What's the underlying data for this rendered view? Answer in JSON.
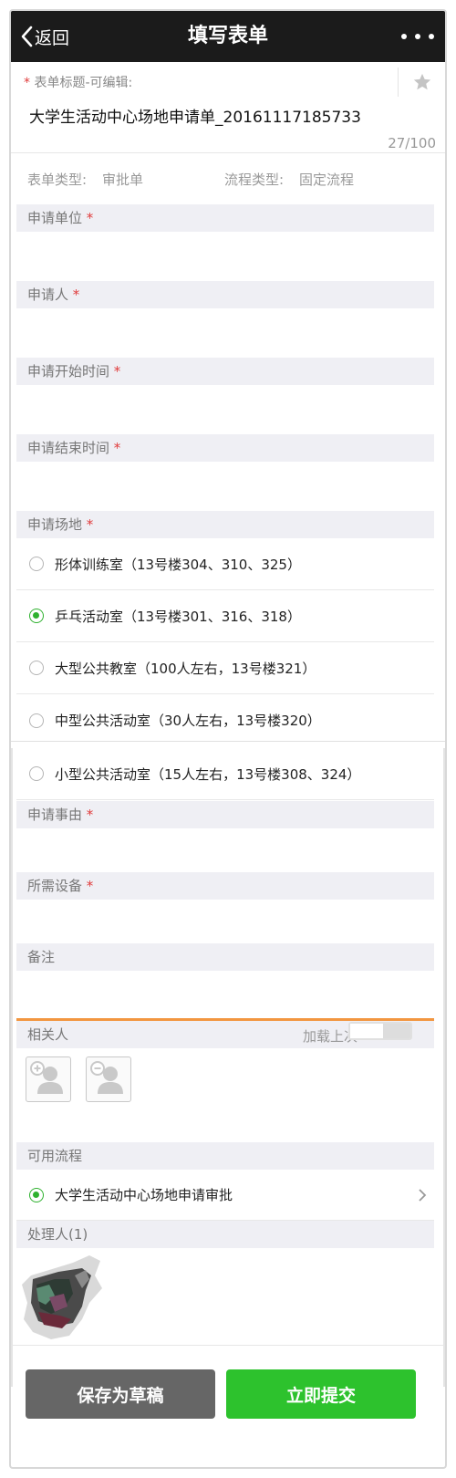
{
  "nav": {
    "back_label": "返回",
    "title": "填写表单"
  },
  "form_title": {
    "label": "表单标题-可编辑:",
    "required_mark": "*",
    "value": "大学生活动中心场地申请单_20161117185733",
    "char_count": "27/100"
  },
  "form_type": {
    "label": "表单类型:",
    "value": "审批单"
  },
  "flow_type": {
    "label": "流程类型:",
    "value": "固定流程"
  },
  "fields": {
    "unit": {
      "label": "申请单位",
      "required_mark": "*"
    },
    "applicant": {
      "label": "申请人",
      "required_mark": "*"
    },
    "start_time": {
      "label": "申请开始时间",
      "required_mark": "*"
    },
    "end_time": {
      "label": "申请结束时间",
      "required_mark": "*"
    },
    "venue": {
      "label": "申请场地",
      "required_mark": "*"
    },
    "reason": {
      "label": "申请事由",
      "required_mark": "*"
    },
    "equipment": {
      "label": "所需设备",
      "required_mark": "*"
    },
    "remarks": {
      "label": "备注"
    }
  },
  "venue_options": [
    {
      "label": "形体训练室（13号楼304、310、325）",
      "selected": false
    },
    {
      "label": "乒乓活动室（13号楼301、316、318）",
      "selected": true
    },
    {
      "label": "大型公共教室（100人左右，13号楼321）",
      "selected": false
    },
    {
      "label": "中型公共活动室（30人左右，13号楼320）",
      "selected": false
    },
    {
      "label": "小型公共活动室（15人左右，13号楼308、324）",
      "selected": false
    }
  ],
  "related": {
    "label": "相关人",
    "load_last_label": "加载上次",
    "load_last_on": false
  },
  "available_flows": {
    "label": "可用流程",
    "selected_flow": "大学生活动中心场地申请审批"
  },
  "handlers": {
    "label": "处理人(1)"
  },
  "footer": {
    "draft_label": "保存为草稿",
    "submit_label": "立即提交"
  },
  "colors": {
    "accent_green": "#2dc22d",
    "navbar_bg": "#1b1b1b",
    "required_red": "#e03c3c",
    "divider_orange": "#f29640"
  },
  "icons": [
    "chevron-left-icon",
    "more-icon",
    "star-icon",
    "add-person-icon",
    "remove-person-icon",
    "chevron-right-icon"
  ]
}
